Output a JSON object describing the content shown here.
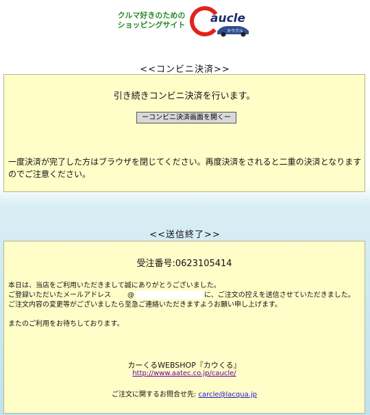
{
  "logo": {
    "tagline_line1": "クルマ好きのための",
    "tagline_line2": "ショッピングサイト",
    "brand": "Caucle",
    "brand_kana": "カウクル"
  },
  "convenience": {
    "title": "<<コンビニ決済>>",
    "lead": "引き続きコンビニ決済を行います。",
    "button_label": "ーコンビニ決済画面を開くー",
    "note": "一度決済が完了した方はブラウザを閉じてください。再度決済をされると二重の決済となりますのでご注意ください。"
  },
  "complete": {
    "title": "<<送信終了>>",
    "order_number": "受注番号:0623105414",
    "line1": "本日は、当店をご利用いただきまして誠にありがとうございました。",
    "line2a": "ご登録いただいたメールアドレス",
    "line2_at": "@",
    "line2b": "に、ご注文の控えを送信させていただきました。",
    "line3": "ご注文内容の変更等がございましたら至急ご連絡いただきますようお願い申し上げます。",
    "line4": "またのご利用をお待ちしております。",
    "shop_name": "カーくるWEBSHOP『カウくる』",
    "shop_url": "http://www.aatec.co.jp/caucle/",
    "contact_label": "ご注文に関するお問合せ先:",
    "contact_email": "carcle@lacqua.jp"
  },
  "colors": {
    "box_bg": "#fffdc8",
    "logo_red": "#e2231a",
    "logo_green": "#2a8a2a",
    "link": "#1a1acc"
  }
}
